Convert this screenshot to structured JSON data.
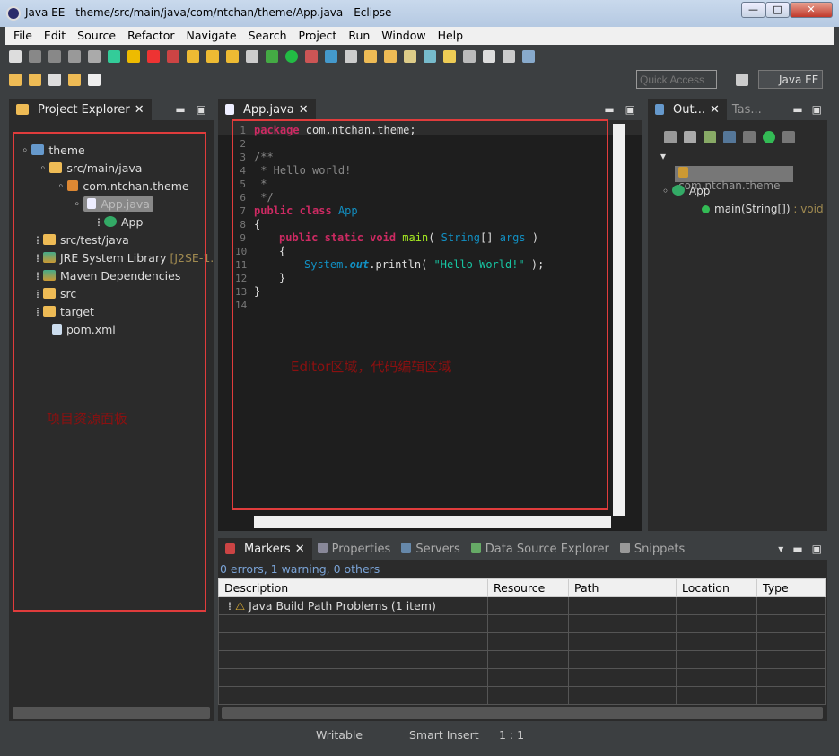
{
  "window": {
    "title": "Java EE - theme/src/main/java/com/ntchan/theme/App.java - Eclipse",
    "minimize": "—",
    "maximize": "□",
    "close": "✕"
  },
  "menu": [
    "File",
    "Edit",
    "Source",
    "Refactor",
    "Navigate",
    "Search",
    "Project",
    "Run",
    "Window",
    "Help"
  ],
  "toolbar": {
    "quick_access_placeholder": "Quick Access",
    "perspective": "Java EE"
  },
  "project_explorer": {
    "tab": "Project Explorer",
    "items": [
      {
        "label": "theme",
        "icon": "project-icon"
      },
      {
        "label": "src/main/java",
        "icon": "source-folder-icon"
      },
      {
        "label": "com.ntchan.theme",
        "icon": "package-icon"
      },
      {
        "label": "App.java",
        "icon": "java-file-icon"
      },
      {
        "label": "App",
        "icon": "class-icon"
      },
      {
        "label": "src/test/java",
        "icon": "source-folder-icon"
      },
      {
        "label": "JRE System Library",
        "suffix": "[J2SE-1.",
        "icon": "library-icon"
      },
      {
        "label": "Maven Dependencies",
        "icon": "library-icon"
      },
      {
        "label": "src",
        "icon": "folder-icon"
      },
      {
        "label": "target",
        "icon": "folder-icon"
      },
      {
        "label": "pom.xml",
        "icon": "maven-file-icon"
      }
    ],
    "annotation": "项目资源面板"
  },
  "editor": {
    "tab": "App.java",
    "line_numbers": [
      "1",
      "2",
      "3",
      "4",
      "5",
      "6",
      "7",
      "8",
      "9",
      "10",
      "11",
      "12",
      "13",
      "14"
    ],
    "lines": {
      "l1a": "package",
      "l1b": " com.ntchan.theme;",
      "l3": "/**",
      "l4": " * Hello world!",
      "l5": " *",
      "l6": " */",
      "l7a": "public class",
      "l7b": "App",
      "l8": "{",
      "l9a": "public static void",
      "l9b": "main",
      "l9c": "( ",
      "l9d": "String",
      "l9e": "[] ",
      "l9f": "args",
      "l9g": " )",
      "l10": "{",
      "l11a": "System.",
      "l11b": "out",
      "l11c": ".println( ",
      "l11d": "\"Hello World!\"",
      "l11e": " );",
      "l12": "}",
      "l13": "}"
    },
    "annotation": "Editor区域，代码编辑区域"
  },
  "outline": {
    "tab": "Out...",
    "tab2": "Tas...",
    "items": [
      {
        "label": "com.ntchan.theme"
      },
      {
        "label": "App"
      },
      {
        "label": "main(String[])",
        "type": " : void"
      }
    ]
  },
  "bottom": {
    "tabs": [
      "Markers",
      "Properties",
      "Servers",
      "Data Source Explorer",
      "Snippets"
    ],
    "summary": "0 errors, 1 warning, 0 others",
    "columns": [
      "Description",
      "Resource",
      "Path",
      "Location",
      "Type"
    ],
    "rows": [
      {
        "description": "Java Build Path Problems (1 item)"
      }
    ]
  },
  "status": {
    "writable": "Writable",
    "insert": "Smart Insert",
    "position": "1 : 1"
  },
  "colors": {
    "annotation_box": "#e03c3c",
    "background": "#2b2b2b",
    "keyword": "#cc2a62"
  }
}
